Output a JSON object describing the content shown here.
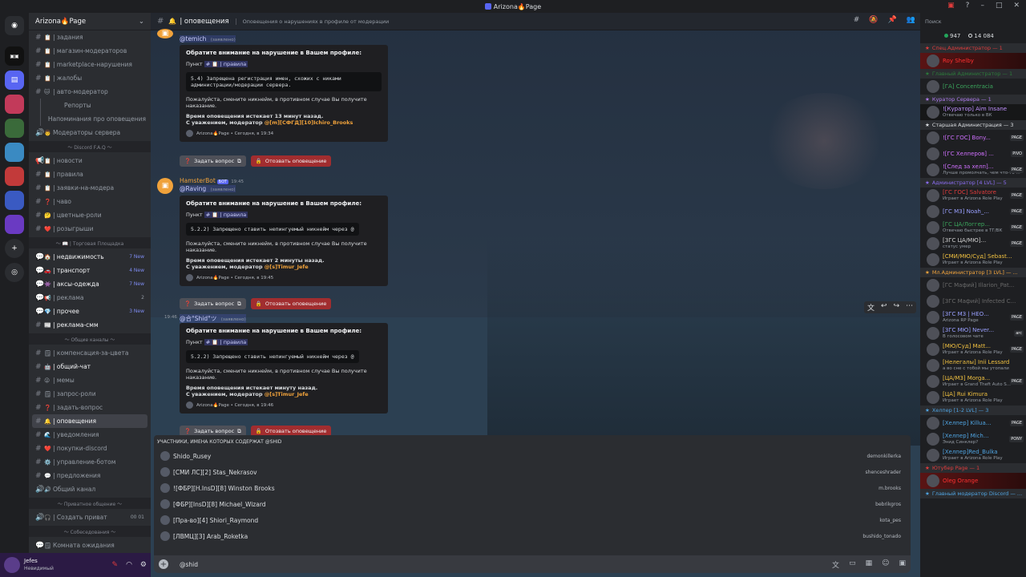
{
  "window": {
    "title": "Arizona🔥Page"
  },
  "server": {
    "name": "Arizona🔥Page"
  },
  "channels": [
    {
      "icon": "#",
      "emoji": "📋",
      "name": "| задания",
      "style": "",
      "count": ""
    },
    {
      "icon": "#",
      "emoji": "📋",
      "name": "| магазин-модераторов",
      "style": "",
      "count": ""
    },
    {
      "icon": "#",
      "emoji": "📋",
      "name": "| marketplace-нарушения",
      "style": "",
      "count": ""
    },
    {
      "icon": "#",
      "emoji": "📋",
      "name": "| жалобы",
      "style": "",
      "count": ""
    },
    {
      "icon": "#",
      "emoji": "🐱",
      "name": "| авто-модератор",
      "style": "",
      "count": ""
    },
    {
      "icon": "",
      "emoji": "",
      "name": "Репорты",
      "style": "sub",
      "count": ""
    },
    {
      "icon": "",
      "emoji": "",
      "name": "Напоминания про оповещения",
      "style": "sub",
      "count": ""
    },
    {
      "icon": "🔊",
      "emoji": "👨",
      "name": "Модераторы сервера",
      "style": "",
      "count": ""
    },
    {
      "cat": "〜 Discord F.A.Q 〜"
    },
    {
      "icon": "📢",
      "emoji": "📋",
      "name": "| новости",
      "style": "",
      "count": ""
    },
    {
      "icon": "#",
      "emoji": "📋",
      "name": "| правила",
      "style": "",
      "count": ""
    },
    {
      "icon": "#",
      "emoji": "📋",
      "name": "| заявки-на-модера",
      "style": "",
      "count": ""
    },
    {
      "icon": "#",
      "emoji": "❓",
      "name": "| чаво",
      "style": "",
      "count": ""
    },
    {
      "icon": "#",
      "emoji": "🤔",
      "name": "| цветные-роли",
      "style": "",
      "count": ""
    },
    {
      "icon": "#",
      "emoji": "❤️",
      "name": "| розыгрыши",
      "style": "",
      "count": ""
    },
    {
      "cat": "〜 📖 | Торговая Площадка"
    },
    {
      "icon": "💬",
      "emoji": "🏠",
      "name": "| недвижимость",
      "style": "bright",
      "count": "7 New",
      "blue": true
    },
    {
      "icon": "💬",
      "emoji": "🚗",
      "name": "| транспорт",
      "style": "bright",
      "count": "4 New",
      "blue": true
    },
    {
      "icon": "💬",
      "emoji": "👾",
      "name": "| аксы-одежда",
      "style": "bright",
      "count": "7 New",
      "blue": true
    },
    {
      "icon": "💬",
      "emoji": "📢",
      "name": "| реклама",
      "style": "",
      "count": "2",
      "blue": false
    },
    {
      "icon": "💬",
      "emoji": "💎",
      "name": "| прочее",
      "style": "bright",
      "count": "3 New",
      "blue": true
    },
    {
      "icon": "#",
      "emoji": "📰",
      "name": "| реклама-смм",
      "style": "bright",
      "count": ""
    },
    {
      "cat": "〜 Общие каналы 〜"
    },
    {
      "icon": "#",
      "emoji": "🗒",
      "name": "| компенсация-за-цвета",
      "style": "",
      "count": ""
    },
    {
      "icon": "#",
      "emoji": "🤖",
      "name": "| общий-чат",
      "style": "bright",
      "count": ""
    },
    {
      "icon": "#",
      "emoji": "😜",
      "name": "| мемы",
      "style": "",
      "count": ""
    },
    {
      "icon": "#",
      "emoji": "🗒",
      "name": "| запрос-роли",
      "style": "",
      "count": ""
    },
    {
      "icon": "#",
      "emoji": "❓",
      "name": "| задать-вопрос",
      "style": "",
      "count": ""
    },
    {
      "icon": "#",
      "emoji": "🔔",
      "name": "| оповещения",
      "style": "sel",
      "count": ""
    },
    {
      "icon": "#",
      "emoji": "🌊",
      "name": "| уведомления",
      "style": "",
      "count": ""
    },
    {
      "icon": "#",
      "emoji": "❤️",
      "name": "| покупки-discord",
      "style": "",
      "count": ""
    },
    {
      "icon": "#",
      "emoji": "⚙️",
      "name": "| управление-ботом",
      "style": "",
      "count": ""
    },
    {
      "icon": "#",
      "emoji": "💬",
      "name": "| предложения",
      "style": "",
      "count": ""
    },
    {
      "icon": "🔊",
      "emoji": "🔊",
      "name": "Общий канал",
      "style": "",
      "count": ""
    },
    {
      "cat": "〜 Приватное общение 〜"
    },
    {
      "icon": "🔊",
      "emoji": "🎧",
      "name": "| Создать приват",
      "style": "",
      "count": "00 01"
    },
    {
      "cat": "〜 Собеседования 〜"
    },
    {
      "icon": "💬",
      "emoji": "🗒",
      "name": "Комната ожидания",
      "style": "",
      "count": ""
    }
  ],
  "user": {
    "name": "Jefes",
    "status": "Невидимый"
  },
  "header": {
    "channel": "| оповещения",
    "topic": "Оповещения о нарушениях в профиле от модерации"
  },
  "search": {
    "placeholder": "Поиск"
  },
  "messages": [
    {
      "author": "",
      "bot": "",
      "time": "",
      "mention": "@temich",
      "mention_tag": "(заявлено)",
      "embed": {
        "title": "Обратите внимание на нарушение в Вашем профиле:",
        "point": "Пункт",
        "rule_chan": "# 📋 | правила",
        "code": "5.4) Запрещена регистрация имен, схожих с никами администрации/модерации сервера.",
        "please": "Пожалуйста, смените никнейм, в противном случае Вы получите наказание.",
        "expire": "Время оповещения истекает 13 минут назад.",
        "regards": "С уважением, модератор",
        "moderator": "@[m][СФГД][10]Ichiro_Brooks",
        "footer": "Arizona🔥Page • Сегодня, в 19:34"
      },
      "ask": "Задать вопрос",
      "revoke": "Отозвать оповещение"
    },
    {
      "author": "HamsterBot",
      "bot": "БОТ",
      "time": "19:45",
      "mention": "@Raving",
      "mention_tag": "(заявлено)",
      "embed": {
        "title": "Обратите внимание на нарушение в Вашем профиле:",
        "point": "Пункт",
        "rule_chan": "# 📋 | правила",
        "code": "5.2.2) Запрещено ставить непингуемый никнейм через @",
        "please": "Пожалуйста, смените никнейм, в противном случае Вы получите наказание.",
        "expire": "Время оповещения истекает 2 минуты назад.",
        "regards": "С уважением, модератор",
        "moderator": "@[s]Timur_Jefe",
        "footer": "Arizona🔥Page • Сегодня, в 19:45"
      },
      "ask": "Задать вопрос",
      "revoke": "Отозвать оповещение"
    },
    {
      "author": "",
      "bot": "",
      "time": "19:46",
      "mention": "@合°Shid°ツ",
      "mention_tag": "(заявлено)",
      "embed": {
        "title": "Обратите внимание на нарушение в Вашем профиле:",
        "point": "Пункт",
        "rule_chan": "# 📋 | правила",
        "code": "5.2.2) Запрещено ставить непингуемый никнейм через @",
        "please": "Пожалуйста, смените никнейм, в противном случае Вы получите наказание.",
        "expire": "Время оповещения истекает минуту назад.",
        "regards": "С уважением, модератор",
        "moderator": "@[s]Timur_Jefe",
        "footer": "Arizona🔥Page • Сегодня, в 19:46"
      },
      "ask": "Задать вопрос",
      "revoke": "Отозвать оповещение"
    }
  ],
  "autocomplete": {
    "title": "УЧАСТНИКИ, ИМЕНА КОТОРЫХ СОДЕРЖАТ @SHID",
    "rows": [
      {
        "name": "Shido_Rusey",
        "user": "demonkillerka"
      },
      {
        "name": "[СМИ ЛС][2] Stas_Nekrasov",
        "user": "shenceshrader"
      },
      {
        "name": "![ФБР][Н.InsD][8] Winston Brooks",
        "user": "m.brooks"
      },
      {
        "name": "[ФБР][InsD][8] Michael_Wizard",
        "user": "bebrikgros"
      },
      {
        "name": "[Пра-во][4] Shiori_Raymond",
        "user": "kota_pes"
      },
      {
        "name": "[ЛВМЦ][3] Arab_Roketka",
        "user": "bushido_tonado"
      }
    ]
  },
  "composer": {
    "text": "@shid"
  },
  "member_counts": {
    "online": "947",
    "total": "14 084"
  },
  "members": [
    {
      "role": "Спец.Администратор — 1",
      "color": "#e03c3c"
    },
    {
      "name": "Roy Shelby",
      "color": "#ff3030",
      "style": "red",
      "status": "",
      "tag": ""
    },
    {
      "role": "Главный Администратор — 1",
      "color": "#2c7a3a"
    },
    {
      "name": "[ГА] Concentracia",
      "color": "#3ba55c",
      "style": "",
      "status": "",
      "tag": ""
    },
    {
      "role": "Куратор Сервера — 1",
      "color": "#b07cf0"
    },
    {
      "name": "![Куратор] Aim Insane",
      "color": "#c090ff",
      "style": "dk",
      "status": "Отвечаю только в ВК",
      "tag": ""
    },
    {
      "role": "Старшая Администрация — 3",
      "color": "#dbdee1"
    },
    {
      "name": "![ГС ГОС] Bony...",
      "color": "#d070ff",
      "style": "",
      "status": "",
      "tag": "PAGE"
    },
    {
      "name": "![ГС Хелперов] ...",
      "color": "#d070ff",
      "style": "",
      "status": "",
      "tag": "PIVO"
    },
    {
      "name": "![След за хелп]...",
      "color": "#d070ff",
      "style": "",
      "status": "Лучше промолчать, чем что-то ...",
      "tag": "PAGE"
    },
    {
      "role": "Администратор [4 LVL] — 5",
      "color": "#8a6cf0"
    },
    {
      "name": "[ГС ГОС] Salvatore",
      "color": "#e03c3c",
      "style": "",
      "status": "Играет в Arizona Role Play",
      "tag": "PAGE"
    },
    {
      "name": "[ГС МЗ] Noah_...",
      "color": "#9aa0ff",
      "style": "",
      "status": "",
      "tag": "PAGE"
    },
    {
      "name": "[ГС ЦА/Логгер...",
      "color": "#3ba55c",
      "style": "",
      "status": "Отвечаю быстрее в ТГ/ВК",
      "tag": "PAGE"
    },
    {
      "name": "[ЗГС ЦА/МЮ]...",
      "color": "#d0d0d0",
      "style": "",
      "status": "статус умер",
      "tag": "PAGE"
    },
    {
      "name": "[СМИ/МЮ/Суд] Sebast...",
      "color": "#f0c040",
      "style": "",
      "status": "Играет в Arizona Role Play",
      "tag": ""
    },
    {
      "role": "Мл.Администратор [3 LVL] — ...",
      "color": "#f0a23b"
    },
    {
      "name": "[ГС Мафий] Illarion_Pat...",
      "color": "#6a6a6a",
      "style": "",
      "status": "",
      "tag": ""
    },
    {
      "name": "[ЗГС Мафий] Infected C...",
      "color": "#6a6a6a",
      "style": "",
      "status": "",
      "tag": ""
    },
    {
      "name": "[ЗГС МЗ | НЕО...",
      "color": "#9aa0ff",
      "style": "",
      "status": "Arizona RP Page",
      "tag": "PAGE"
    },
    {
      "name": "[ЗГС МЮ] Never...",
      "color": "#9aa0ff",
      "style": "",
      "status": "В голосовом чате",
      "tag": "arc"
    },
    {
      "name": "[МЮ/Суд] Matt...",
      "color": "#f0c040",
      "style": "",
      "status": "Играет в Arizona Role Play",
      "tag": "PAGE"
    },
    {
      "name": "[Нелегалы] Inii Lessard",
      "color": "#f0c040",
      "style": "",
      "status": "а во сне с тобой мы утопали",
      "tag": ""
    },
    {
      "name": "[ЦА/МЗ] Morga...",
      "color": "#f0c040",
      "style": "",
      "status": "Играет в Grand Theft Auto S...",
      "tag": "PAGE"
    },
    {
      "name": "[ЦА] Rui Kimura",
      "color": "#f0c040",
      "style": "",
      "status": "Играет в Arizona Role Play",
      "tag": ""
    },
    {
      "role": "Хелпер [1-2 LVL] — 3",
      "color": "#4fa3e0"
    },
    {
      "name": "[Хелпер] Killua...",
      "color": "#4fa3e0",
      "style": "",
      "status": "",
      "tag": "PAGE"
    },
    {
      "name": "[Хелпер] Mich...",
      "color": "#4fa3e0",
      "style": "",
      "status": "Энид Синклер?",
      "tag": "PONY"
    },
    {
      "name": "[Хелпер]Red_Bulka",
      "color": "#4fa3e0",
      "style": "",
      "status": "Играет в Arizona Role Play",
      "tag": ""
    },
    {
      "role": "Ютубер Page — 1",
      "color": "#e03c3c"
    },
    {
      "name": "Oleg Orange",
      "color": "#ff3030",
      "style": "red",
      "status": "",
      "tag": ""
    },
    {
      "role": "Главный модератор Discord — ...",
      "color": "#4fa3e0"
    }
  ]
}
